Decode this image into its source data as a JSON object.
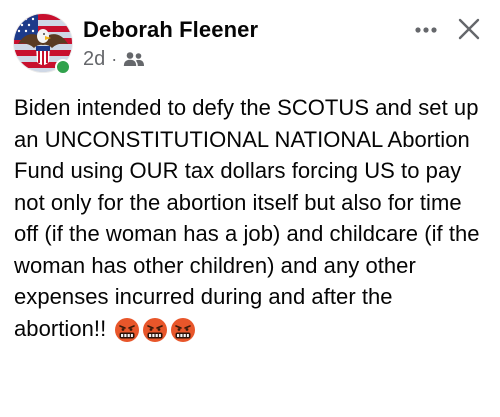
{
  "post": {
    "author": {
      "name": "Deborah Fleener",
      "avatar_icon": "eagle-flag-avatar",
      "online": true,
      "online_color": "#31a24c"
    },
    "meta": {
      "time": "2d",
      "separator": "·",
      "audience_icon": "friends-icon"
    },
    "actions": {
      "more_icon": "more-horizontal-icon",
      "close_icon": "close-icon"
    },
    "text": "Biden intended to defy the SCOTUS and set up an UNCONSTITUTIONAL NATIONAL Abortion Fund using OUR tax dollars forcing US to pay not only for the abortion itself but also for time off (if the woman has a job) and childcare (if the woman has other children) and any other expenses incurred during and after the abortion!!",
    "emojis": [
      "face-with-symbols-on-mouth",
      "face-with-symbols-on-mouth",
      "face-with-symbols-on-mouth"
    ]
  },
  "colors": {
    "text": "#050505",
    "secondary_text": "#65676b",
    "emoji_face": "#e8562a"
  }
}
